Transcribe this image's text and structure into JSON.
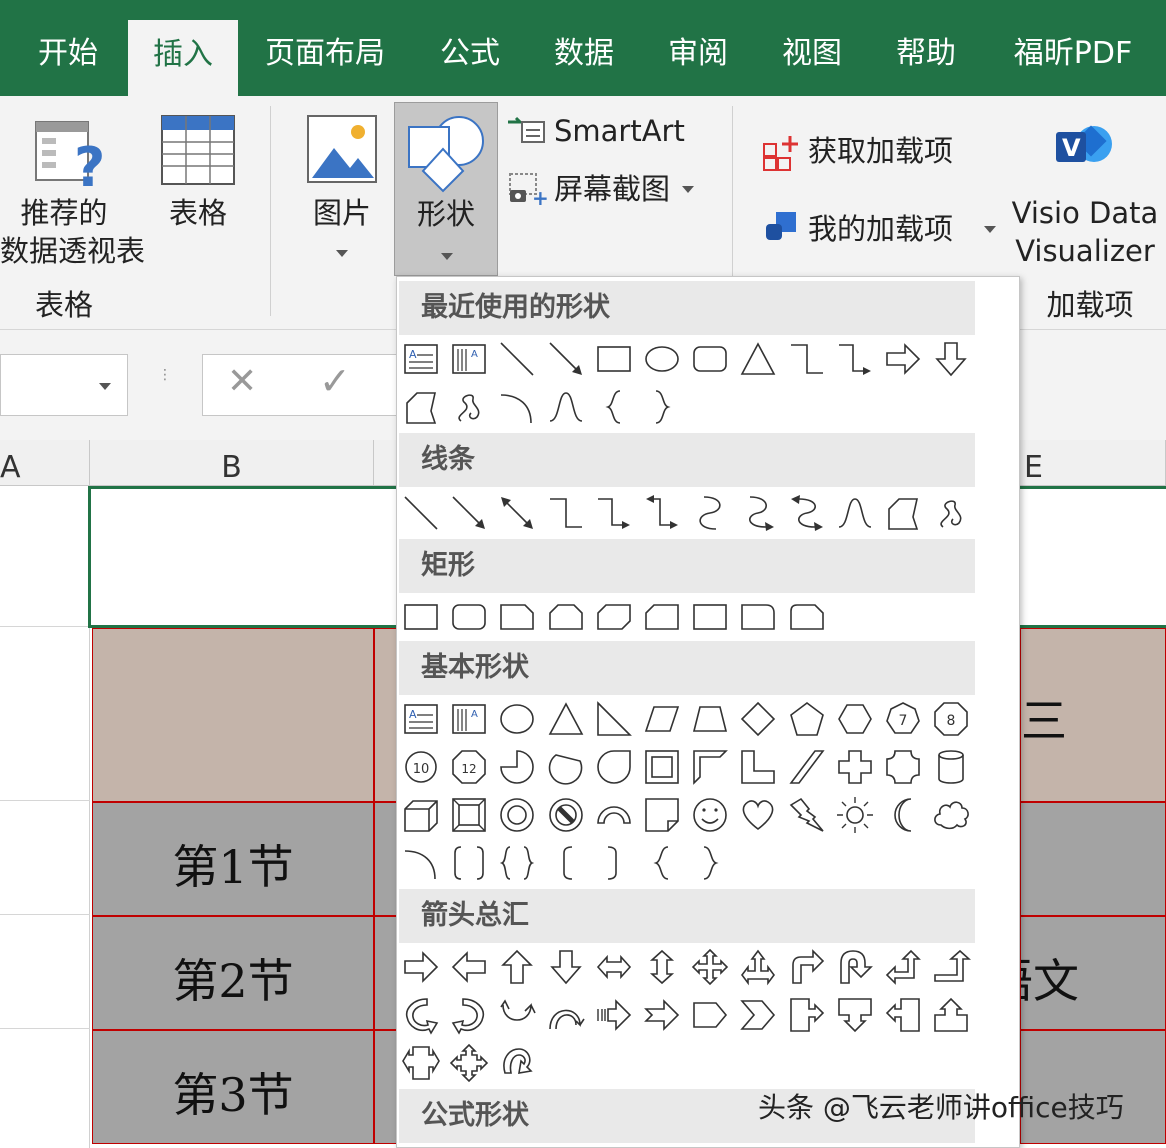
{
  "tabs": [
    "开始",
    "插入",
    "页面布局",
    "公式",
    "数据",
    "审阅",
    "视图",
    "帮助",
    "福昕PDF"
  ],
  "active_tab": "插入",
  "ribbon": {
    "pivot_label_1": "推荐的",
    "pivot_label_2": "数据透视表",
    "table_label": "表格",
    "group_tables": "表格",
    "picture_label": "图片",
    "shapes_label": "形状",
    "smartart_label": "SmartArt",
    "screenshot_label": "屏幕截图",
    "get_addins_label": "获取加载项",
    "my_addins_label": "我的加载项",
    "visio_label_1": "Visio Data",
    "visio_label_2": "Visualizer",
    "group_addins": "加载项"
  },
  "formula_bar": {
    "cancel": "✕",
    "confirm": "✓"
  },
  "columns": [
    "A",
    "B",
    "E"
  ],
  "cells": {
    "row1": "第1节",
    "row2": "第2节",
    "row3": "第3节",
    "e_header": "三",
    "e_row2": "语文"
  },
  "shapes_menu": {
    "sections": [
      "最近使用的形状",
      "线条",
      "矩形",
      "基本形状",
      "箭头总汇",
      "公式形状"
    ],
    "number_shapes": [
      "7",
      "8",
      "10",
      "12"
    ]
  },
  "colors": {
    "accent": "#217346",
    "cell_border": "#c00000",
    "header_fill": "#c4b4aa",
    "row_fill": "#a3a3a3"
  },
  "watermark": "头条 @飞云老师讲office技巧"
}
